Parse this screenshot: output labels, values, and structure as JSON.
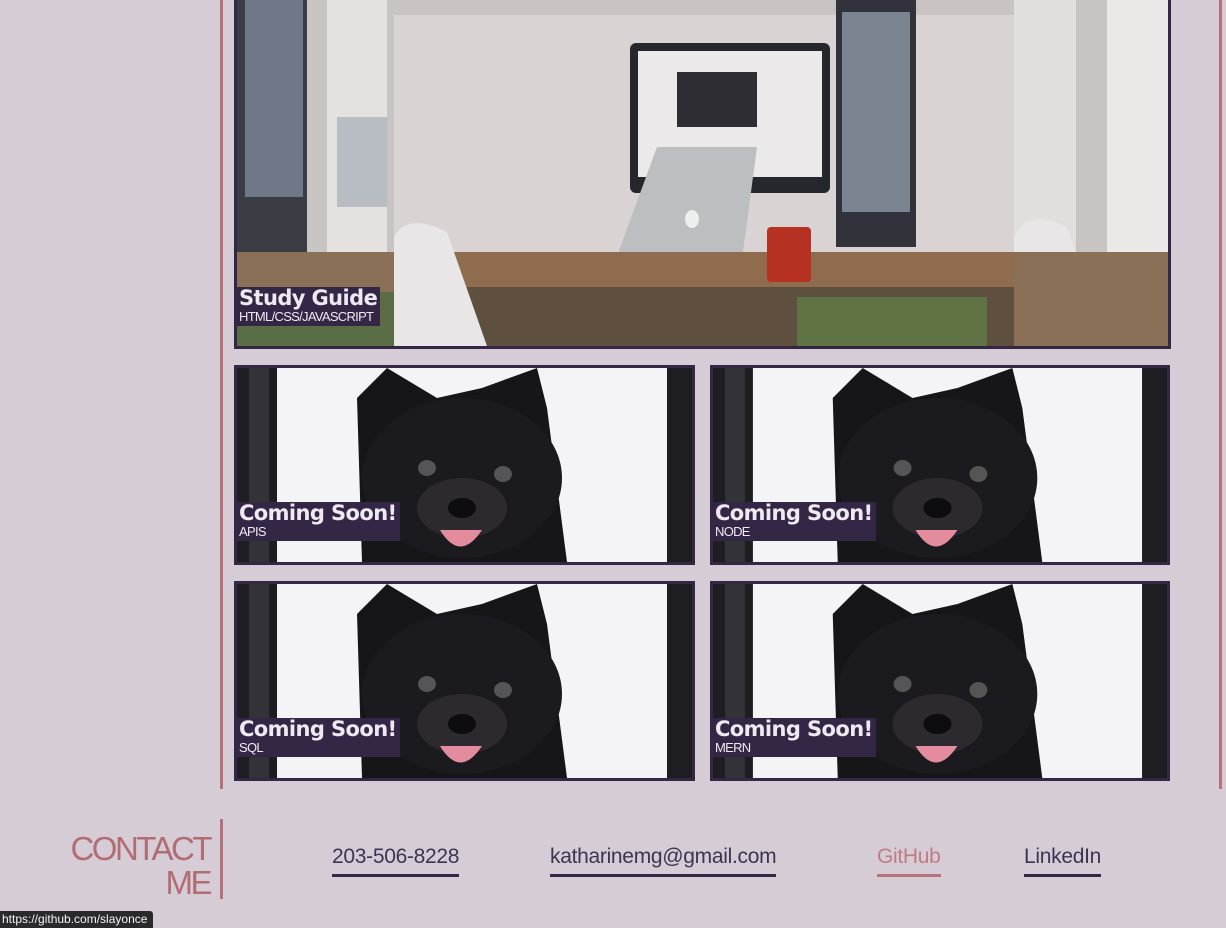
{
  "featured_project": {
    "title": "Study Guide",
    "subtitle": "HTML/CSS/JAVASCRIPT"
  },
  "projects": [
    {
      "title": "Coming Soon!",
      "subtitle": "APIS"
    },
    {
      "title": "Coming Soon!",
      "subtitle": "NODE"
    },
    {
      "title": "Coming Soon!",
      "subtitle": "SQL"
    },
    {
      "title": "Coming Soon!",
      "subtitle": "MERN"
    }
  ],
  "contact": {
    "heading_line1": "CONTACT",
    "heading_line2": "ME",
    "links": [
      {
        "label": "203-506-8228"
      },
      {
        "label": "katharinemg@gmail.com"
      },
      {
        "label": "GitHub",
        "active": true
      },
      {
        "label": "LinkedIn"
      }
    ]
  },
  "status_bar": {
    "url": "https://github.com/slayonce"
  },
  "colors": {
    "background": "#d5ccd6",
    "accent": "#b67179",
    "card_border": "#342746",
    "caption_bg": "#342746"
  }
}
